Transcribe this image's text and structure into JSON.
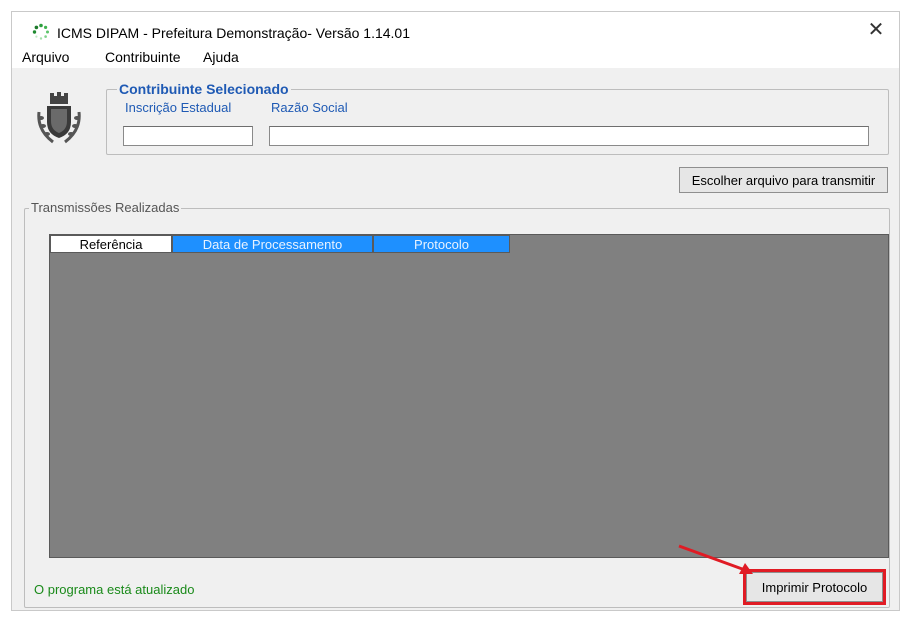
{
  "window": {
    "title": "ICMS DIPAM - Prefeitura  Demonstração- Versão 1.14.01",
    "close": "✕"
  },
  "menu": [
    "Arquivo",
    "Contribuinte",
    "Ajuda"
  ],
  "contribuinte": {
    "legend": "Contribuinte Selecionado",
    "inscricao_label": "Inscrição Estadual",
    "inscricao_value": "",
    "razao_label": "Razão Social",
    "razao_value": ""
  },
  "buttons": {
    "escolher": "Escolher arquivo para transmitir",
    "imprimir": "Imprimir Protocolo"
  },
  "transmissoes": {
    "legend": "Transmissões Realizadas",
    "columns": [
      "Referência",
      "Data de Processamento",
      "Protocolo"
    ],
    "rows": []
  },
  "status": "O programa está atualizado",
  "colors": {
    "accent": "#1f5ab4",
    "header_selected": "#1e90ff",
    "grid_bg": "#808080",
    "status_ok": "#1a8a1a",
    "highlight": "#e01b24"
  },
  "icons": {
    "app": "spinner-icon",
    "crest": "coat-of-arms-icon",
    "annotation": "red-arrow-annotation"
  }
}
